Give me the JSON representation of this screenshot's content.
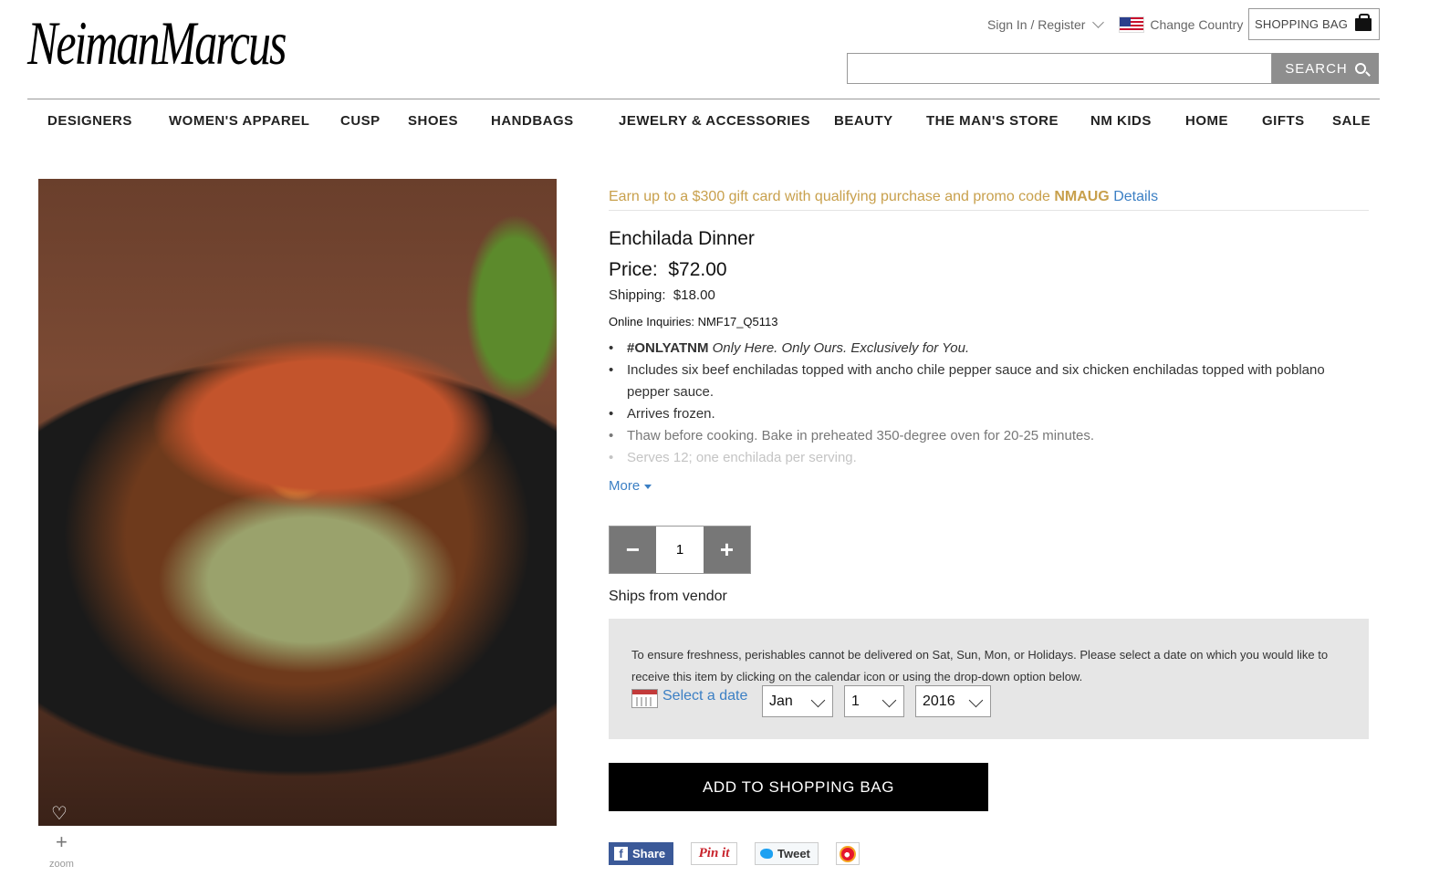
{
  "header": {
    "logo": "NeimanMarcus",
    "signin": "Sign In / Register",
    "change_country": "Change Country",
    "shopping_bag": "SHOPPING BAG",
    "search_value": "",
    "search_button": "SEARCH"
  },
  "nav": [
    "DESIGNERS",
    "WOMEN'S APPAREL",
    "CUSP",
    "SHOES",
    "HANDBAGS",
    "JEWELRY & ACCESSORIES",
    "BEAUTY",
    "THE MAN'S STORE",
    "NM KIDS",
    "HOME",
    "GIFTS",
    "SALE"
  ],
  "image": {
    "zoom_label": "zoom"
  },
  "product": {
    "promo_text": "Earn up to a $300 gift card with qualifying purchase and promo code",
    "promo_code": "NMAUG",
    "promo_link": "Details",
    "title": "Enchilada Dinner",
    "price_label": "Price:",
    "price": "$72.00",
    "shipping_label": "Shipping:",
    "shipping": "$18.00",
    "inquiries_label": "Online Inquiries:",
    "inquiries": "NMF17_Q5113",
    "bullet_tag": "#ONLYATNM",
    "bullet_tag_rest": "Only Here. Only Ours. Exclusively for You.",
    "bullets": [
      "Includes six beef enchiladas topped with ancho chile pepper sauce and six chicken enchiladas topped with poblano pepper sauce.",
      "Arrives frozen.",
      "Thaw before cooking. Bake in preheated 350-degree oven for 20-25 minutes.",
      "Serves 12; one enchilada per serving."
    ],
    "more": "More",
    "quantity": "1",
    "ships_from": "Ships from vendor",
    "delivery_note": "To ensure freshness, perishables cannot be delivered on Sat, Sun, Mon, or Holidays. Please select a date on which you would like to receive this item by clicking on the calendar icon or using the drop-down option below.",
    "select_date": "Select a date",
    "month": "Jan",
    "day": "1",
    "year": "2016",
    "add_to_bag": "ADD TO SHOPPING BAG"
  },
  "social": {
    "facebook": "Share",
    "pinterest": "Pin it",
    "twitter": "Tweet"
  },
  "colors": {
    "promo": "#c8a04c",
    "link": "#3b7fc4",
    "button": "#000000"
  }
}
